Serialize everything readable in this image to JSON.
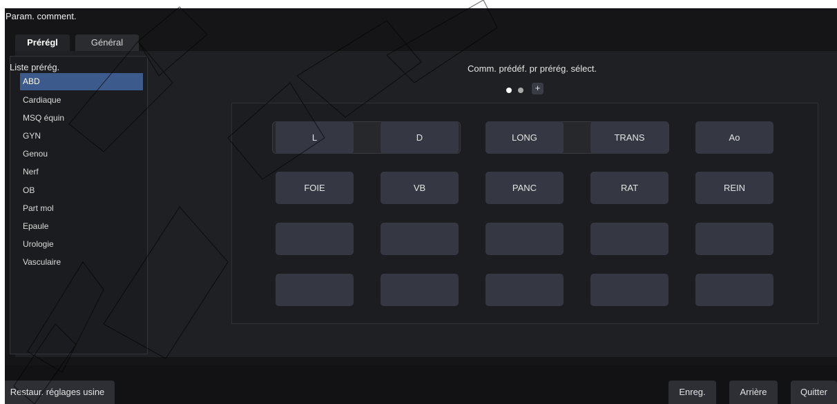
{
  "window": {
    "title": "Param. comment."
  },
  "tabs": [
    {
      "label": "Prérégl",
      "active": true
    },
    {
      "label": "Général",
      "active": false
    }
  ],
  "preset_list": {
    "title": "Liste prérég.",
    "items": [
      "ABD",
      "Cardiaque",
      "MSQ équin",
      "GYN",
      "Genou",
      "Nerf",
      "OB",
      "Part mol",
      "Epaule",
      "Urologie",
      "Vasculaire"
    ],
    "selected": "ABD"
  },
  "comments": {
    "title": "Comm. prédéf. pr prérég. sélect.",
    "pager": {
      "pages": 2,
      "current": 1,
      "add_label": "+"
    },
    "rows": [
      [
        "L",
        "D",
        "LONG",
        "TRANS",
        "Ao"
      ],
      [
        "FOIE",
        "VB",
        "PANC",
        "RAT",
        "REIN"
      ],
      [
        "",
        "",
        "",
        "",
        ""
      ],
      [
        "",
        "",
        "",
        "",
        ""
      ]
    ]
  },
  "buttons": {
    "restore": "Restaur. réglages usine",
    "save": "Enreg.",
    "back": "Arrière",
    "quit": "Quitter"
  },
  "colors": {
    "background": "#151517",
    "panel": "#1f2023",
    "selected_item": "#3d5a8c",
    "comment_button": "#353842"
  }
}
